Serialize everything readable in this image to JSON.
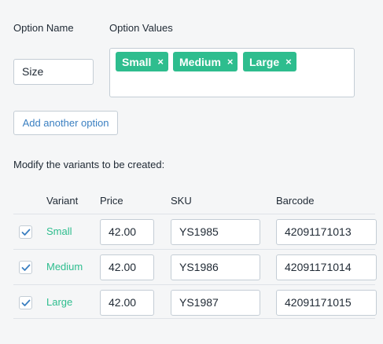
{
  "labels": {
    "option_name": "Option Name",
    "option_values": "Option Values",
    "modify_heading": "Modify the variants to be created:"
  },
  "option": {
    "name_value": "Size",
    "values": [
      {
        "label": "Small",
        "remove": "×"
      },
      {
        "label": "Medium",
        "remove": "×"
      },
      {
        "label": "Large",
        "remove": "×"
      }
    ]
  },
  "buttons": {
    "add_option": "Add another option"
  },
  "table": {
    "headers": {
      "variant": "Variant",
      "price": "Price",
      "sku": "SKU",
      "barcode": "Barcode"
    },
    "rows": [
      {
        "checked": true,
        "variant": "Small",
        "price": "42.00",
        "sku": "YS1985",
        "barcode": "42091171013"
      },
      {
        "checked": true,
        "variant": "Medium",
        "price": "42.00",
        "sku": "YS1986",
        "barcode": "42091171014"
      },
      {
        "checked": true,
        "variant": "Large",
        "price": "42.00",
        "sku": "YS1987",
        "barcode": "42091171015"
      }
    ]
  },
  "colors": {
    "accent_green": "#2ebd8e",
    "link_blue": "#3a7fc1",
    "checkbox_blue": "#3a7fc1",
    "background": "#f5f6f7"
  },
  "icons": {
    "tag_remove": "close-icon",
    "checkbox": "checkmark-icon"
  }
}
